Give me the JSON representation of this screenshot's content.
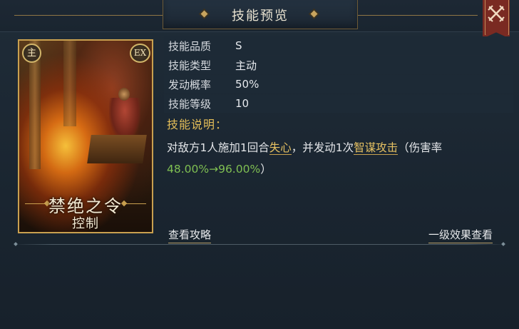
{
  "window": {
    "title": "技能预览",
    "close_icon": "crossed-swords-close-icon"
  },
  "card": {
    "badge_main": "主",
    "badge_ex": "EX",
    "name": "禁绝之令",
    "type": "控制"
  },
  "info": [
    {
      "key": "技能品质",
      "value": "S"
    },
    {
      "key": "技能类型",
      "value": "主动"
    },
    {
      "key": "发动概率",
      "value": "50%"
    },
    {
      "key": "技能等级",
      "value": "10"
    }
  ],
  "description": {
    "heading": "技能说明：",
    "part1": "对敌方1人施加1回合",
    "link1": "失心",
    "part2": "，并发动1次",
    "link2": "智谋攻击",
    "part3": "（伤害率",
    "rate": "48.00%→96.00%",
    "part4": "）"
  },
  "footer": {
    "guide_link": "查看攻略",
    "effect_link": "一级效果查看"
  },
  "colors": {
    "accent_gold": "#e3bd58",
    "rate_green": "#7fbf52",
    "close_red": "#7a2a22"
  }
}
